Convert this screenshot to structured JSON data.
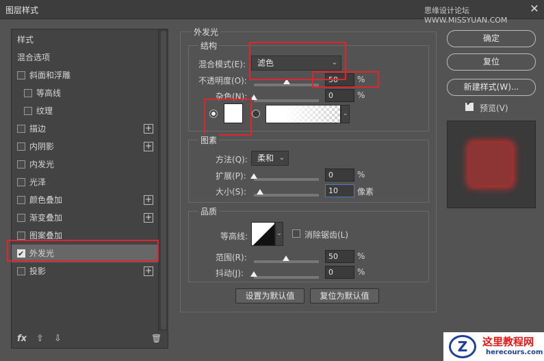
{
  "window": {
    "title": "图层样式",
    "watermark": "思缘设计论坛 WWW.MISSYUAN.COM",
    "close": "✕"
  },
  "left": {
    "items": [
      {
        "label": "样式",
        "checkbox": false
      },
      {
        "label": "混合选项",
        "checkbox": false
      },
      {
        "label": "斜面和浮雕",
        "checkbox": true,
        "checked": false
      },
      {
        "label": "等高线",
        "checkbox": true,
        "checked": false,
        "indent": true
      },
      {
        "label": "纹理",
        "checkbox": true,
        "checked": false,
        "indent": true
      },
      {
        "label": "描边",
        "checkbox": true,
        "checked": false,
        "plus": true
      },
      {
        "label": "内阴影",
        "checkbox": true,
        "checked": false,
        "plus": true
      },
      {
        "label": "内发光",
        "checkbox": true,
        "checked": false
      },
      {
        "label": "光泽",
        "checkbox": true,
        "checked": false
      },
      {
        "label": "颜色叠加",
        "checkbox": true,
        "checked": false,
        "plus": true
      },
      {
        "label": "渐变叠加",
        "checkbox": true,
        "checked": false,
        "plus": true
      },
      {
        "label": "图案叠加",
        "checkbox": true,
        "checked": false
      },
      {
        "label": "外发光",
        "checkbox": true,
        "checked": true,
        "selected": true
      },
      {
        "label": "投影",
        "checkbox": true,
        "checked": false,
        "plus": true
      }
    ],
    "plus": "+",
    "footer": {
      "fx": "fx",
      "up": "⇧",
      "down": "⇩",
      "trash": "🗑"
    }
  },
  "outer_glow": {
    "title": "外发光",
    "structure": {
      "title": "结构",
      "blend_mode_label": "混合模式(E):",
      "blend_mode_value": "滤色",
      "opacity_label": "不透明度(O):",
      "opacity_value": "50",
      "opacity_unit": "%",
      "opacity_level": 0.5,
      "noise_label": "杂色(N):",
      "noise_value": "0",
      "noise_unit": "%",
      "noise_level": 0.0
    },
    "elements": {
      "title": "图素",
      "technique_label": "方法(Q):",
      "technique_value": "柔和",
      "spread_label": "扩展(P):",
      "spread_value": "0",
      "spread_unit": "%",
      "size_label": "大小(S):",
      "size_value": "10",
      "size_unit": "像素"
    },
    "quality": {
      "title": "品质",
      "contour_label": "等高线:",
      "antialias_label": "消除锯齿(L)",
      "range_label": "范围(R):",
      "range_value": "50",
      "range_unit": "%",
      "jitter_label": "抖动(J):",
      "jitter_value": "0",
      "jitter_unit": "%"
    },
    "buttons": {
      "make_default": "设置为默认值",
      "reset_default": "复位为默认值"
    }
  },
  "right": {
    "ok": "确定",
    "reset": "复位",
    "new_style": "新建样式(W)...",
    "preview_label": "预览(V)",
    "preview_checked": true
  },
  "logo": {
    "mark": "Z",
    "title": "这里教程网",
    "url": "herecours.com"
  },
  "colors": {
    "highlight": "#e0262b",
    "glow": "#c42f2f"
  }
}
